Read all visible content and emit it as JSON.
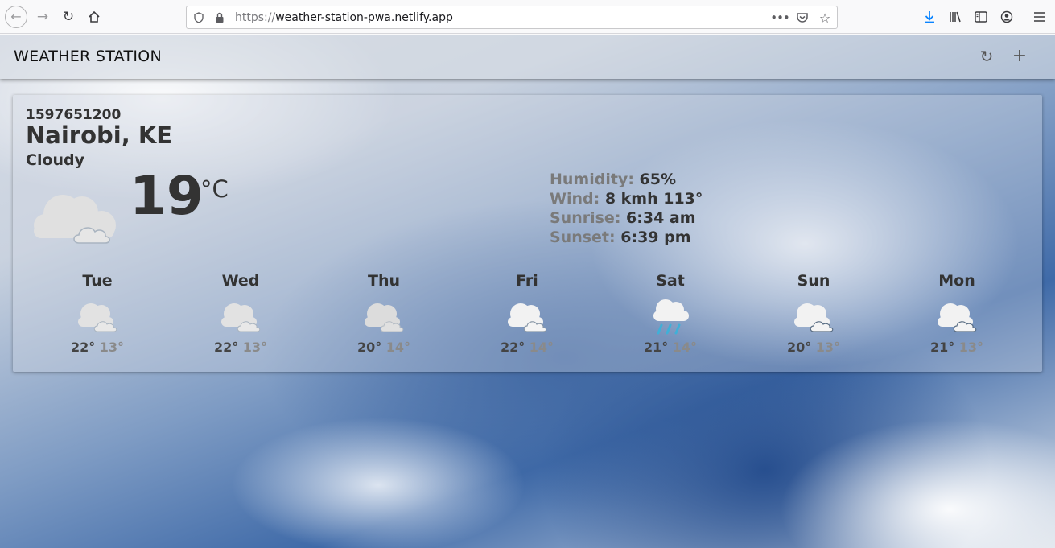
{
  "browser": {
    "url_scheme": "https://",
    "url_host": "weather-station-pwa.netlify.app",
    "back_icon": "arrow-left-icon",
    "forward_icon": "arrow-right-icon",
    "reload_icon": "reload-icon",
    "home_icon": "home-icon"
  },
  "header": {
    "title": "WEATHER STATION",
    "refresh_icon": "refresh-icon",
    "add_icon": "plus-icon"
  },
  "current": {
    "date": "1597651200",
    "location": "Nairobi, KE",
    "description": "Cloudy",
    "temperature": "19",
    "unit": "°C",
    "icon": "cloudy-icon",
    "details": {
      "humidity_label": "Humidity:",
      "humidity_value": "65%",
      "wind_label": "Wind:",
      "wind_value": "8 kmh 113°",
      "sunrise_label": "Sunrise:",
      "sunrise_value": "6:34 am",
      "sunset_label": "Sunset:",
      "sunset_value": "6:39 pm"
    }
  },
  "forecast": [
    {
      "day": "Tue",
      "hi": "22°",
      "lo": "13°",
      "icon": "cloudy-icon"
    },
    {
      "day": "Wed",
      "hi": "22°",
      "lo": "13°",
      "icon": "cloudy-icon"
    },
    {
      "day": "Thu",
      "hi": "20°",
      "lo": "14°",
      "icon": "cloudy-icon"
    },
    {
      "day": "Fri",
      "hi": "22°",
      "lo": "14°",
      "icon": "partly-cloudy-icon"
    },
    {
      "day": "Sat",
      "hi": "21°",
      "lo": "14°",
      "icon": "rain-icon"
    },
    {
      "day": "Sun",
      "hi": "20°",
      "lo": "13°",
      "icon": "partly-cloudy-icon"
    },
    {
      "day": "Mon",
      "hi": "21°",
      "lo": "13°",
      "icon": "partly-cloudy-icon"
    }
  ]
}
